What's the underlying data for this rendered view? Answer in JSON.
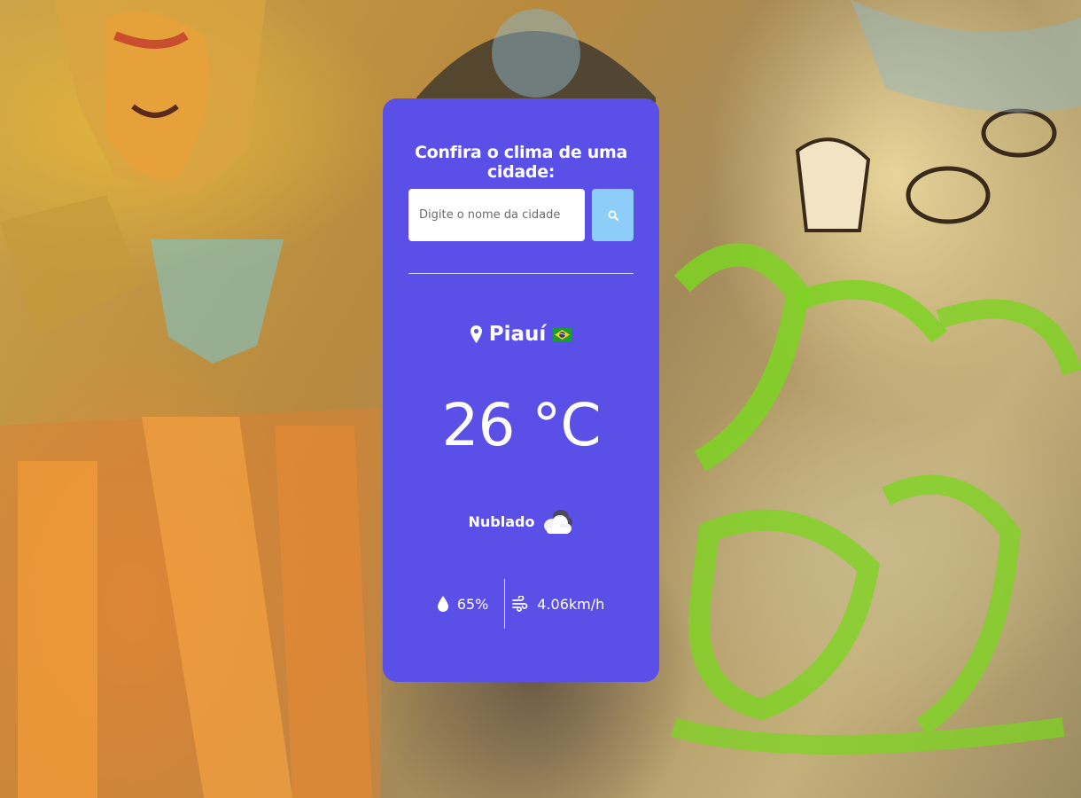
{
  "widget": {
    "title": "Confira o clima de uma cidade:",
    "search": {
      "placeholder": "Digite o nome da cidade",
      "value": "",
      "button_icon": "search-icon"
    },
    "location": {
      "icon": "location-pin-icon",
      "city": "Piauí",
      "country_flag": "brazil-flag-icon"
    },
    "temperature": "26 °C",
    "condition": {
      "text": "Nublado",
      "icon": "cloud-icon"
    },
    "humidity": {
      "icon": "droplet-icon",
      "value": "65%"
    },
    "wind": {
      "icon": "wind-icon",
      "value": "4.06km/h"
    }
  },
  "colors": {
    "card_background": "#5a4fe6",
    "search_button": "#8ecdf7",
    "text": "#ffffff"
  }
}
